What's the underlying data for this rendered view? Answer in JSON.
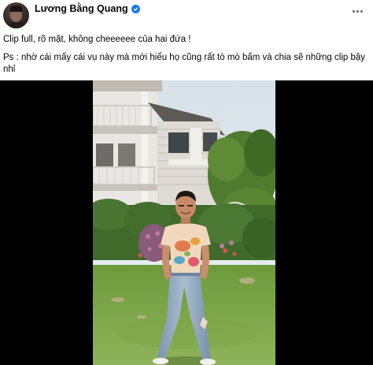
{
  "post": {
    "author": {
      "name": "Lương Bằng Quang",
      "verified_icon": "verified-badge-icon",
      "avatar_icon": "profile-avatar"
    },
    "more_icon": "more-options-icon",
    "caption_line1": "Clip full, rõ mặt, không cheeeeee của hai đứa !",
    "caption_line2": "Ps : nhờ cái mấy cái vụ này mà mới hiểu họ cũng rất tò mò bấm và chia sẽ những clip bậy nhỉ"
  },
  "video": {
    "description": "",
    "letterbox_color": "#000000"
  },
  "colors": {
    "accent": "#1877f2",
    "text": "#050505",
    "icon_gray": "#65676b"
  }
}
